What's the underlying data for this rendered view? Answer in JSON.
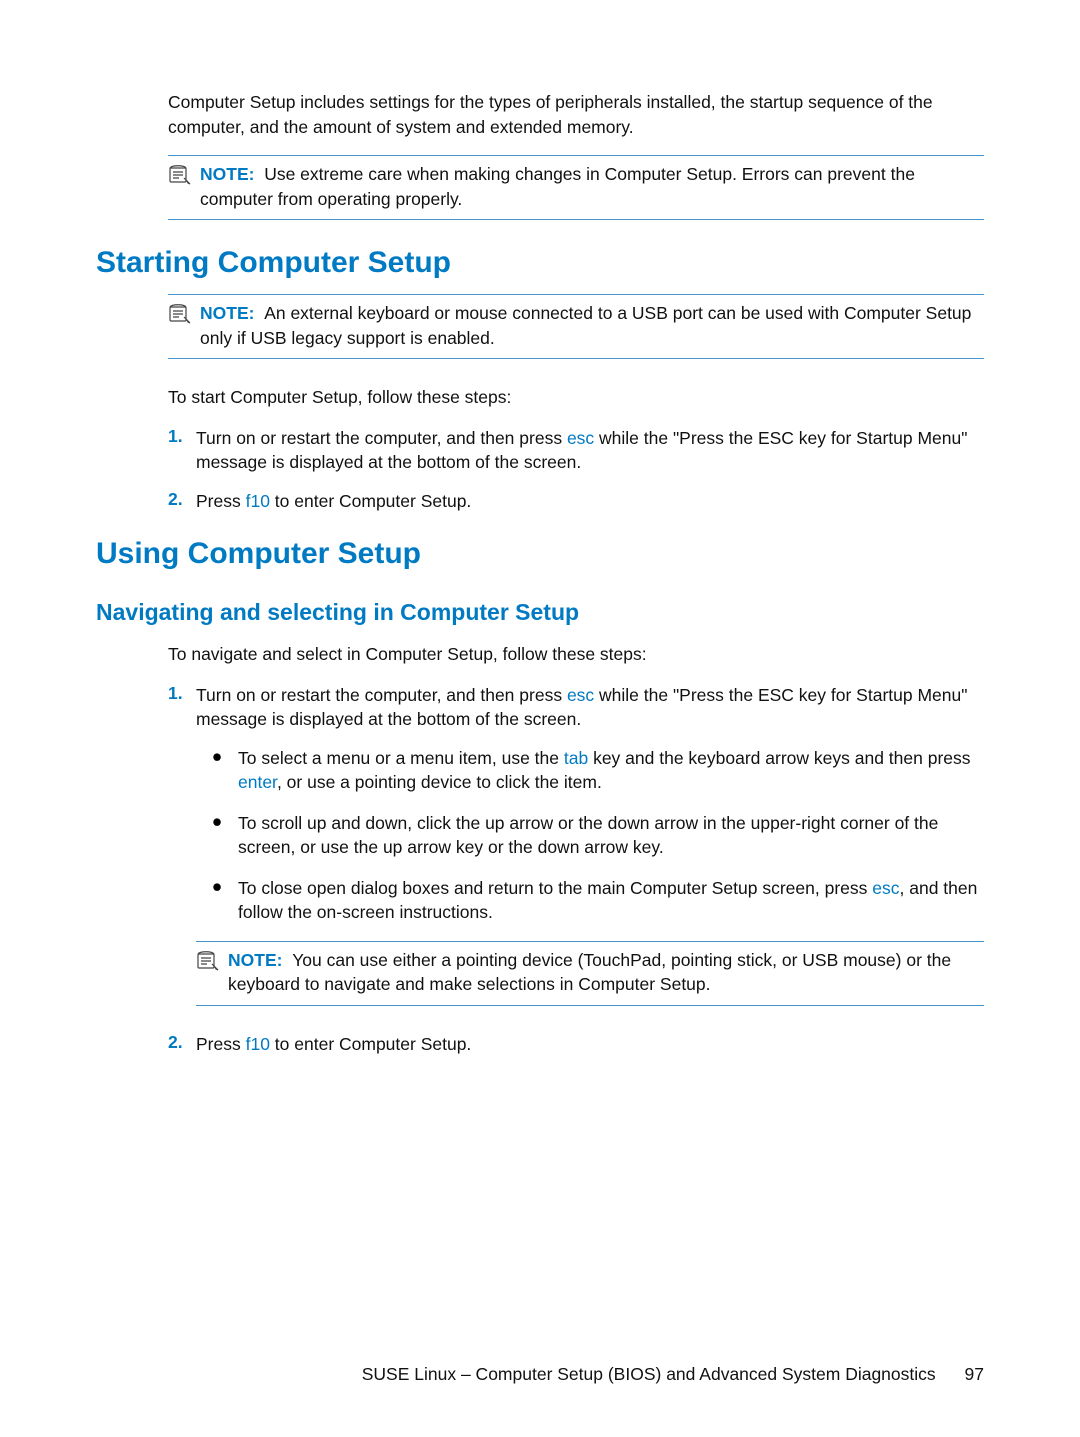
{
  "intro_para": "Computer Setup includes settings for the types of peripherals installed, the startup sequence of the computer, and the amount of system and extended memory.",
  "note1": {
    "label": "NOTE:",
    "text": "Use extreme care when making changes in Computer Setup. Errors can prevent the computer from operating properly."
  },
  "h1a": "Starting Computer Setup",
  "note2": {
    "label": "NOTE:",
    "text": "An external keyboard or mouse connected to a USB port can be used with Computer Setup only if USB legacy support is enabled."
  },
  "start_intro": "To start Computer Setup, follow these steps:",
  "start_steps": {
    "s1": {
      "marker": "1.",
      "pre": "Turn on or restart the computer, and then press ",
      "key": "esc",
      "post": " while the \"Press the ESC key for Startup Menu\" message is displayed at the bottom of the screen."
    },
    "s2": {
      "marker": "2.",
      "pre": "Press ",
      "key": "f10",
      "post": " to enter Computer Setup."
    }
  },
  "h1b": "Using Computer Setup",
  "h2a": "Navigating and selecting in Computer Setup",
  "nav_intro": "To navigate and select in Computer Setup, follow these steps:",
  "nav_step1": {
    "marker": "1.",
    "pre": "Turn on or restart the computer, and then press ",
    "key": "esc",
    "post": " while the \"Press the ESC key for Startup Menu\" message is displayed at the bottom of the screen."
  },
  "bullets": {
    "b1": {
      "pre": "To select a menu or a menu item, use the ",
      "key1": "tab",
      "mid": " key and the keyboard arrow keys and then press ",
      "key2": "enter",
      "post": ", or use a pointing device to click the item."
    },
    "b2": "To scroll up and down, click the up arrow or the down arrow in the upper-right corner of the screen, or use the up arrow key or the down arrow key.",
    "b3": {
      "pre": "To close open dialog boxes and return to the main Computer Setup screen, press ",
      "key": "esc",
      "post": ", and then follow the on-screen instructions."
    }
  },
  "note3": {
    "label": "NOTE:",
    "text": "You can use either a pointing device (TouchPad, pointing stick, or USB mouse) or the keyboard to navigate and make selections in Computer Setup."
  },
  "nav_step2": {
    "marker": "2.",
    "pre": "Press ",
    "key": "f10",
    "post": " to enter Computer Setup."
  },
  "footer": {
    "text": "SUSE Linux – Computer Setup (BIOS) and Advanced System Diagnostics",
    "page": "97"
  }
}
